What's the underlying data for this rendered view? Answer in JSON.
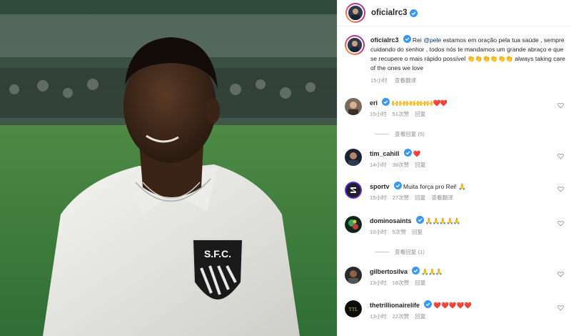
{
  "post": {
    "author": "oficialrc3",
    "image_alt": "Photo of a young footballer in a white Santos jersey with the S.F.C. badge",
    "badge_text": "S.F.C."
  },
  "caption": {
    "username": "oficialrc3",
    "text_before": "Rei ",
    "mention": "@pele",
    "text_after": " estamos em oração pela tua saúde , sempre cuidando do senhor , todos nós te mandamos um grande abraço e que se recupere o mais rápido possível 👏👏👏👏👏👏 always taking care of the ones we love",
    "time": "15小时",
    "translate": "查看翻译"
  },
  "comments": [
    {
      "username": "eri",
      "verified": true,
      "text": "🙌🙌🙌🙌🙌🙌❤️❤️",
      "time": "15小时",
      "likes": "51次赞",
      "reply": "回复",
      "view_replies": "查看回复 (5)"
    },
    {
      "username": "tim_cahill",
      "verified": true,
      "text": "❤️",
      "time": "14小时",
      "likes": "38次赞",
      "reply": "回复"
    },
    {
      "username": "sportv",
      "verified": true,
      "text": "Muita força pro Rei! 🙏",
      "time": "15小时",
      "likes": "27次赞",
      "reply": "回复",
      "translate": "查看翻译"
    },
    {
      "username": "dominosaints",
      "verified": true,
      "text": "🙏🙏🙏🙏🙏",
      "time": "10小时",
      "likes": "5次赞",
      "reply": "回复",
      "view_replies": "查看回复 (1)"
    },
    {
      "username": "gilbertosilva",
      "verified": true,
      "text": "🙏🙏🙏",
      "time": "13小时",
      "likes": "18次赞",
      "reply": "回复"
    },
    {
      "username": "thetrillionairelife",
      "verified": true,
      "text": "❤️❤️❤️❤️❤️",
      "time": "13小时",
      "likes": "22次赞",
      "reply": "回复"
    }
  ],
  "icons": {
    "verified": "verified-badge-icon",
    "like": "heart-outline-icon"
  },
  "colors": {
    "verified": "#3897f0",
    "link": "#00376b",
    "meta": "#8e8e8e",
    "text": "#262626"
  }
}
